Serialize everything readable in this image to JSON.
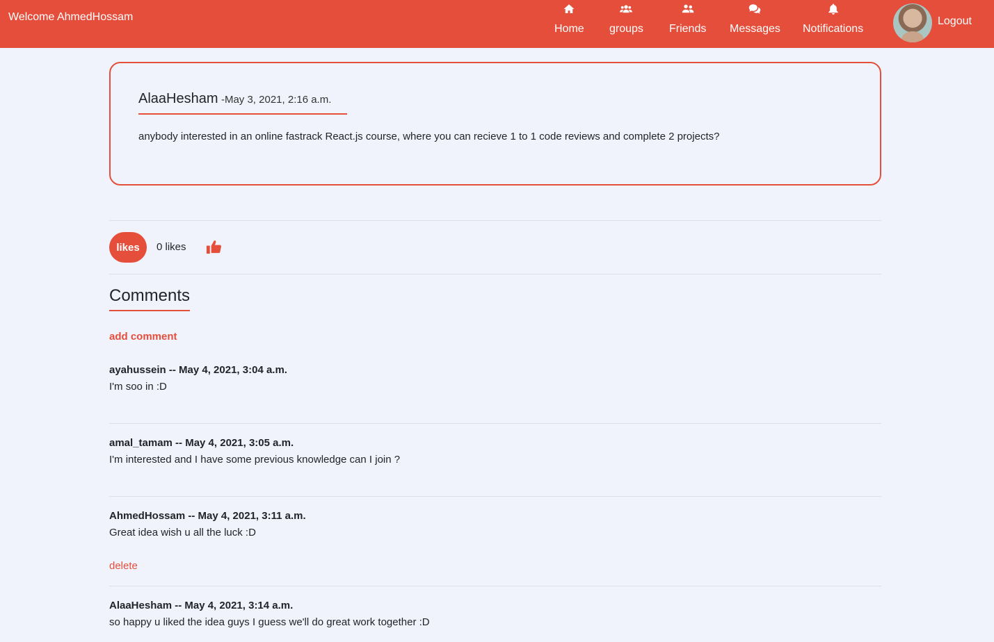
{
  "navbar": {
    "brand": "Welcome AhmedHossam",
    "items": [
      {
        "label": "Home",
        "icon": "home-icon"
      },
      {
        "label": "groups",
        "icon": "users-icon"
      },
      {
        "label": "Friends",
        "icon": "user-friends-icon"
      },
      {
        "label": "Messages",
        "icon": "comments-icon"
      },
      {
        "label": "Notifications",
        "icon": "bell-icon"
      }
    ],
    "logout": "Logout",
    "accent_color": "#e44e3b"
  },
  "post": {
    "author": "AlaaHesham",
    "date": "-May 3, 2021, 2:16 a.m.",
    "text": "anybody interested in an online fastrack React.js course, where you can recieve 1 to 1 code reviews and complete 2 projects?"
  },
  "likes": {
    "button_label": "likes",
    "count_text": "0 likes",
    "icon": "thumbs-up-icon"
  },
  "comments": {
    "title": "Comments",
    "add_label": "add comment",
    "delete_label": "delete",
    "items": [
      {
        "meta": "ayahussein -- May 4, 2021, 3:04 a.m.",
        "text": "I'm soo in :D"
      },
      {
        "meta": "amal_tamam -- May 4, 2021, 3:05 a.m.",
        "text": "I'm interested and I have some previous knowledge can I join ?"
      },
      {
        "meta": "AhmedHossam -- May 4, 2021, 3:11 a.m.",
        "text": "Great idea wish u all the luck :D"
      },
      {
        "meta": "AlaaHesham -- May 4, 2021, 3:14 a.m.",
        "text": "so happy u liked the idea guys I guess we'll do great work together :D"
      }
    ]
  }
}
